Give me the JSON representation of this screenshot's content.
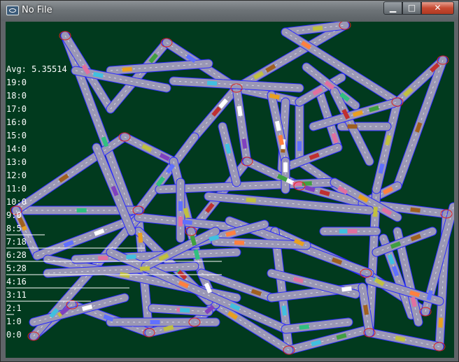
{
  "window": {
    "title": "No File",
    "minimize_glyph": "▁",
    "maximize_glyph": "□",
    "close_glyph": "✕"
  },
  "stats": {
    "avg_label": "Avg:",
    "avg_value": "5.35514",
    "rows": [
      {
        "label": "19:",
        "value": "0"
      },
      {
        "label": "18:",
        "value": "0"
      },
      {
        "label": "17:",
        "value": "0"
      },
      {
        "label": "16:",
        "value": "0"
      },
      {
        "label": "15:",
        "value": "0"
      },
      {
        "label": "14:",
        "value": "0"
      },
      {
        "label": "13:",
        "value": "0"
      },
      {
        "label": "12:",
        "value": "0"
      },
      {
        "label": "11:",
        "value": "0"
      },
      {
        "label": "10:",
        "value": "0"
      },
      {
        "label": "9:",
        "value": "0"
      },
      {
        "label": "8:",
        "value": "5"
      },
      {
        "label": "7:",
        "value": "18"
      },
      {
        "label": "6:",
        "value": "28"
      },
      {
        "label": "5:",
        "value": "28"
      },
      {
        "label": "4:",
        "value": "16"
      },
      {
        "label": "3:",
        "value": "11"
      },
      {
        "label": "2:",
        "value": "1"
      },
      {
        "label": "1:",
        "value": "0"
      },
      {
        "label": "0:",
        "value": "0"
      }
    ]
  },
  "colors": {
    "background": "#013a1e",
    "road": "#9a97b5",
    "road_edge": "#2a2aff",
    "lane_label": "#3030ff",
    "node_label": "#e0201a",
    "histogram_bar": "#ffffff"
  }
}
